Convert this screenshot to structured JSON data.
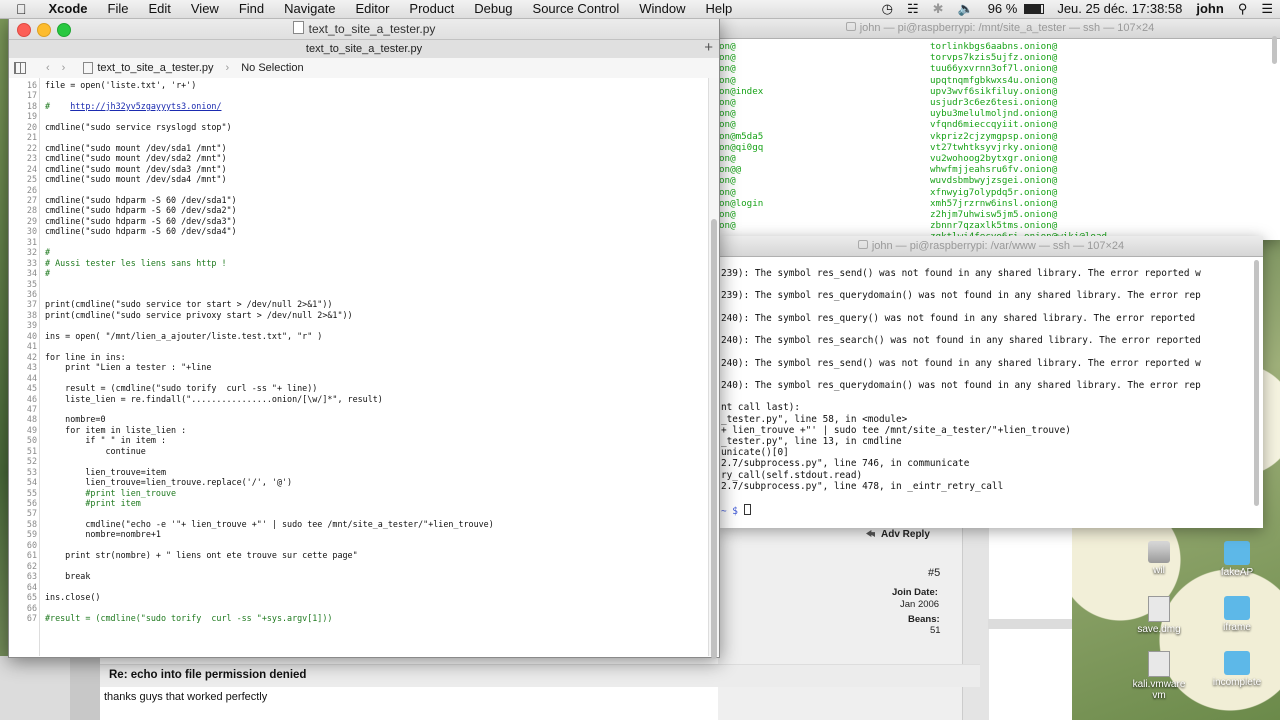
{
  "menubar": {
    "app_name": "Xcode",
    "items": [
      "File",
      "Edit",
      "View",
      "Find",
      "Navigate",
      "Editor",
      "Product",
      "Debug",
      "Source Control",
      "Window",
      "Help"
    ],
    "battery": "96 %",
    "clock": "Jeu. 25 déc.  17:38:58",
    "user": "john"
  },
  "xcode": {
    "window_title": "text_to_site_a_tester.py",
    "tab_title": "text_to_site_a_tester.py",
    "jumpbar_file": "text_to_site_a_tester.py",
    "jumpbar_selection": "No Selection",
    "lines": [
      {
        "n": "16",
        "t": "file = open('liste.txt', 'r+')",
        "k": "code"
      },
      {
        "n": "17",
        "t": "",
        "k": "code"
      },
      {
        "n": "18",
        "t": "#    http://jh32yv5zgayyyts3.onion/",
        "k": "cm"
      },
      {
        "n": "19",
        "t": "",
        "k": "code"
      },
      {
        "n": "20",
        "t": "cmdline(\"sudo service rsyslogd stop\")",
        "k": "code"
      },
      {
        "n": "21",
        "t": "",
        "k": "code"
      },
      {
        "n": "22",
        "t": "cmdline(\"sudo mount /dev/sda1 /mnt\")",
        "k": "code"
      },
      {
        "n": "23",
        "t": "cmdline(\"sudo mount /dev/sda2 /mnt\")",
        "k": "code"
      },
      {
        "n": "24",
        "t": "cmdline(\"sudo mount /dev/sda3 /mnt\")",
        "k": "code"
      },
      {
        "n": "25",
        "t": "cmdline(\"sudo mount /dev/sda4 /mnt\")",
        "k": "code"
      },
      {
        "n": "26",
        "t": "",
        "k": "code"
      },
      {
        "n": "27",
        "t": "cmdline(\"sudo hdparm -S 60 /dev/sda1\")",
        "k": "code"
      },
      {
        "n": "28",
        "t": "cmdline(\"sudo hdparm -S 60 /dev/sda2\")",
        "k": "code"
      },
      {
        "n": "29",
        "t": "cmdline(\"sudo hdparm -S 60 /dev/sda3\")",
        "k": "code"
      },
      {
        "n": "30",
        "t": "cmdline(\"sudo hdparm -S 60 /dev/sda4\")",
        "k": "code"
      },
      {
        "n": "31",
        "t": "",
        "k": "code"
      },
      {
        "n": "32",
        "t": "#",
        "k": "cm"
      },
      {
        "n": "33",
        "t": "# Aussi tester les liens sans http !",
        "k": "cm"
      },
      {
        "n": "34",
        "t": "#",
        "k": "cm"
      },
      {
        "n": "35",
        "t": "",
        "k": "code"
      },
      {
        "n": "36",
        "t": "",
        "k": "code"
      },
      {
        "n": "37",
        "t": "print(cmdline(\"sudo service tor start > /dev/null 2>&1\"))",
        "k": "code"
      },
      {
        "n": "38",
        "t": "print(cmdline(\"sudo service privoxy start > /dev/null 2>&1\"))",
        "k": "code"
      },
      {
        "n": "39",
        "t": "",
        "k": "code"
      },
      {
        "n": "40",
        "t": "ins = open( \"/mnt/lien_a_ajouter/liste.test.txt\", \"r\" )",
        "k": "code"
      },
      {
        "n": "41",
        "t": "",
        "k": "code"
      },
      {
        "n": "42",
        "t": "for line in ins:",
        "k": "code"
      },
      {
        "n": "43",
        "t": "    print \"Lien a tester : \"+line",
        "k": "code"
      },
      {
        "n": "44",
        "t": "",
        "k": "code"
      },
      {
        "n": "45",
        "t": "    result = (cmdline(\"sudo torify  curl -ss \"+ line))",
        "k": "code"
      },
      {
        "n": "46",
        "t": "    liste_lien = re.findall(\"................onion/[\\w/]*\", result)",
        "k": "code"
      },
      {
        "n": "47",
        "t": "",
        "k": "code"
      },
      {
        "n": "48",
        "t": "    nombre=0",
        "k": "code"
      },
      {
        "n": "49",
        "t": "    for item in liste_lien :",
        "k": "code"
      },
      {
        "n": "50",
        "t": "        if \" \" in item :",
        "k": "code"
      },
      {
        "n": "51",
        "t": "            continue",
        "k": "code"
      },
      {
        "n": "52",
        "t": "",
        "k": "code"
      },
      {
        "n": "53",
        "t": "        lien_trouve=item",
        "k": "code"
      },
      {
        "n": "54",
        "t": "        lien_trouve=lien_trouve.replace('/', '@')",
        "k": "code"
      },
      {
        "n": "55",
        "t": "        #print lien_trouve",
        "k": "cm"
      },
      {
        "n": "56",
        "t": "        #print item",
        "k": "cm"
      },
      {
        "n": "57",
        "t": "",
        "k": "code"
      },
      {
        "n": "58",
        "t": "        cmdline(\"echo -e '\"+ lien_trouve +\"' | sudo tee /mnt/site_a_tester/\"+lien_trouve)",
        "k": "code"
      },
      {
        "n": "59",
        "t": "        nombre=nombre+1",
        "k": "code"
      },
      {
        "n": "60",
        "t": "",
        "k": "code"
      },
      {
        "n": "61",
        "t": "    print str(nombre) + \" liens ont ete trouve sur cette page\"",
        "k": "code"
      },
      {
        "n": "62",
        "t": "",
        "k": "code"
      },
      {
        "n": "63",
        "t": "    break",
        "k": "code"
      },
      {
        "n": "64",
        "t": "",
        "k": "code"
      },
      {
        "n": "65",
        "t": "ins.close()",
        "k": "code"
      },
      {
        "n": "66",
        "t": "",
        "k": "code"
      },
      {
        "n": "67",
        "t": "#result = (cmdline(\"sudo torify  curl -ss \"+sys.argv[1]))",
        "k": "cm"
      }
    ]
  },
  "terminal1": {
    "title": "john — pi@raspberrypi: /mnt/site_a_tester — ssh — 107×24",
    "left_col": [
      "on@",
      "on@",
      "on@",
      "on@",
      "on@index",
      "on@",
      "on@",
      "on@",
      "on@m5da5",
      "on@qi0gq",
      "on@",
      "on@@",
      "on@",
      "on@",
      "on@login",
      "on@",
      "on@",
      ""
    ],
    "right_col": [
      "torlinkbgs6aabns.onion@",
      "torvps7kzis5ujfz.onion@",
      "tuu66yxvrnn3of7l.onion@",
      "upqtnqmfgbkwxs4u.onion@",
      "upv3wvf6sikfiluy.onion@",
      "usjudr3c6ez6tesi.onion@",
      "uybu3melulmoljnd.onion@",
      "vfqnd6mieccqyiit.onion@",
      "vkpriz2cjzymgpsp.onion@",
      "vt27twhtksyvjrky.onion@",
      "vu2wohoog2bytxgr.onion@",
      "whwfmjjeahsru6fv.onion@",
      "wuvdsbmbwyjzsgei.onion@",
      "xfnwyig7olypdq5r.onion@",
      "xmh57jrzrnw6insl.onion@",
      "z2hjm7uhwisw5jm5.onion@",
      "zbnnr7qzaxlk5tms.onion@",
      "zqktlwi4fecvo6ri.onion@wiki@load"
    ]
  },
  "terminal2": {
    "title": "john — pi@raspberrypi: /var/www — ssh — 107×24",
    "lines": [
      "239): The symbol res_send() was not found in any shared library. The error reported w",
      "",
      "239): The symbol res_querydomain() was not found in any shared library. The error rep",
      "",
      "240): The symbol res_query() was not found in any shared library. The error reported",
      "",
      "240): The symbol res_search() was not found in any shared library. The error reported",
      "",
      "240): The symbol res_send() was not found in any shared library. The error reported w",
      "",
      "240): The symbol res_querydomain() was not found in any shared library. The error rep",
      "",
      "nt call last):",
      "_tester.py\", line 58, in <module>",
      "+ lien_trouve +\"' | sudo tee /mnt/site_a_tester/\"+lien_trouve)",
      "_tester.py\", line 13, in cmdline",
      "unicate()[0]",
      "2.7/subprocess.py\", line 746, in communicate",
      "ry_call(self.stdout.read)",
      "2.7/subprocess.py\", line 478, in _eintr_retry_call"
    ],
    "prompt": "~ $ "
  },
  "forum": {
    "adv_reply": "Adv Reply",
    "post_number": "#5",
    "join_date_label": "Join Date:",
    "join_date_value": "Jan 2006",
    "beans_label": "Beans:",
    "beans_value": "51",
    "reply_title": "Re: echo into file permission denied",
    "reply_body": "thanks guys that worked perfectly"
  },
  "desktop_icons": [
    {
      "label": "wil",
      "icon": "disk-icon"
    },
    {
      "label": "fakeAP",
      "icon": "folder-icon"
    },
    {
      "label": "save.dmg",
      "icon": "disk-image-icon"
    },
    {
      "label": "iframe",
      "icon": "folder-icon"
    },
    {
      "label": "kali.vmware\nvm",
      "icon": "vm-icon"
    },
    {
      "label": "incomplete",
      "icon": "folder-icon"
    }
  ]
}
